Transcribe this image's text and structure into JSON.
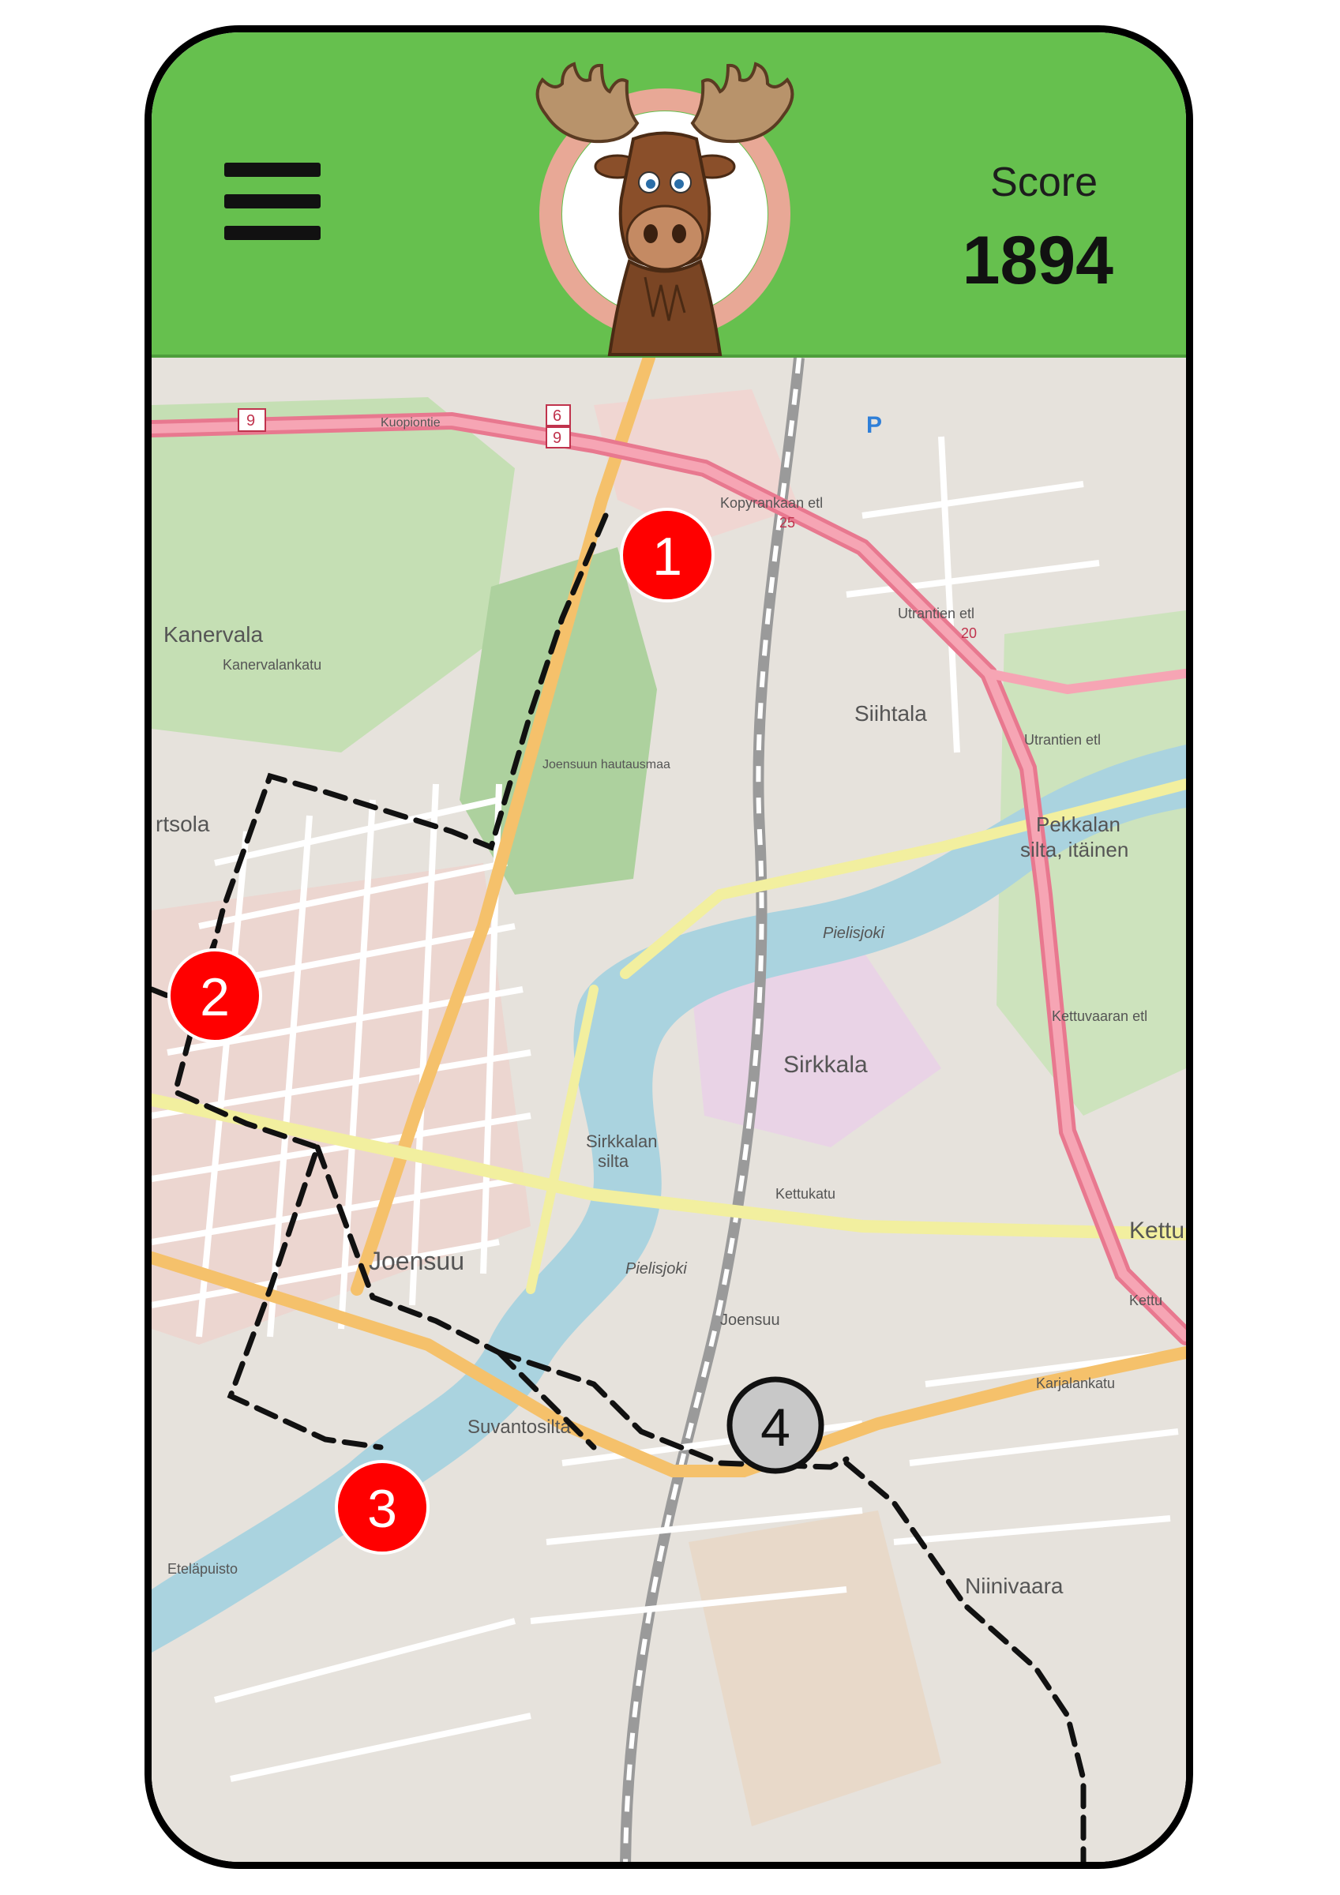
{
  "app": {
    "score_label": "Score",
    "score_value": "1894",
    "menu_icon": "hamburger-menu-icon",
    "mascot_icon": "moose-mascot-icon"
  },
  "map": {
    "labels": {
      "kanervala": "Kanervala",
      "kanervalankatu": "Kanervalankatu",
      "otsola": "rtsola",
      "siihtala": "Siihtala",
      "pekkalan_1": "Pekkalan",
      "pekkalan_2": "silta, itäinen",
      "sirkkala": "Sirkkala",
      "sirkkalan_silta_1": "Sirkkalan",
      "sirkkalan_silta_2": "silta",
      "joensuu": "Joensuu",
      "joensuu_station": "Joensuu",
      "suvantosilta": "Suvantosilta",
      "niinivaara": "Niinivaara",
      "kettu": "Kettu",
      "kuopiontie": "Kuopiontie",
      "kopyrankaan_etl": "Kopyrankaan etl",
      "utrantien_etl": "Utrantien etl",
      "utrantien_etl_2": "Utrantien etl",
      "kettuvaaran_etl": "Kettuvaaran etl",
      "kettu_etl": "Kettu",
      "karjalankatu": "Karjalankatu",
      "kettukatu": "Kettukatu",
      "eteläpuisto": "Eteläpuisto",
      "pielisjoki": "Pielisjoki",
      "pielisjoki_2": "Pielisjoki",
      "hospital": "Joensuun hautausmaa",
      "road_9": "9",
      "road_6": "6",
      "road_9b": "9",
      "road_25": "25",
      "road_20": "20",
      "parking": "P"
    },
    "markers": [
      {
        "number": "1",
        "state": "active",
        "color": "#ff0000"
      },
      {
        "number": "2",
        "state": "active",
        "color": "#ff0000"
      },
      {
        "number": "3",
        "state": "active",
        "color": "#ff0000"
      },
      {
        "number": "4",
        "state": "inactive",
        "color": "#c8c8c8"
      }
    ]
  }
}
